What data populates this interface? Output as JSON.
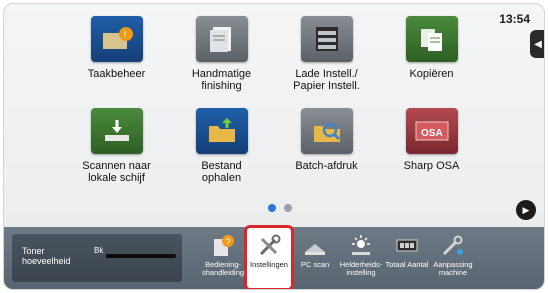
{
  "status": {
    "clock": "13:54"
  },
  "tiles": [
    {
      "label": "Taakbeheer",
      "icon": "job-status-icon"
    },
    {
      "label": "Handmatige\nfinishing",
      "icon": "manual-finishing-icon"
    },
    {
      "label": "Lade Instell./\nPapier Instell.",
      "icon": "tray-settings-icon"
    },
    {
      "label": "Kopiëren",
      "icon": "copy-icon"
    },
    {
      "label": "Scannen naar\nlokale schijf",
      "icon": "scan-local-drive-icon"
    },
    {
      "label": "Bestand\nophalen",
      "icon": "file-retrieve-icon"
    },
    {
      "label": "Batch-afdruk",
      "icon": "batch-print-icon"
    },
    {
      "label": "Sharp OSA",
      "icon": "sharp-osa-icon"
    }
  ],
  "pager": {
    "active_page": 1,
    "pages": 2
  },
  "toner": {
    "label": "Toner\nhoeveelheid",
    "color_code": "Bk",
    "level": 0.95
  },
  "shortcuts": [
    {
      "label": "Bediening-\nshandleiding",
      "icon": "operation-guide-icon"
    },
    {
      "label": "Instellingen",
      "icon": "settings-icon",
      "selected": true
    },
    {
      "label": "PC scan",
      "icon": "pc-scan-icon"
    },
    {
      "label": "Helderheids-\ninstelling",
      "icon": "brightness-icon"
    },
    {
      "label": "Totaal Aantal",
      "icon": "total-count-icon"
    },
    {
      "label": "Aanpassing\nmachine",
      "icon": "customize-machine-icon"
    }
  ],
  "colors": {
    "highlight": "#d9272f",
    "accent": "#2a7ad5"
  }
}
